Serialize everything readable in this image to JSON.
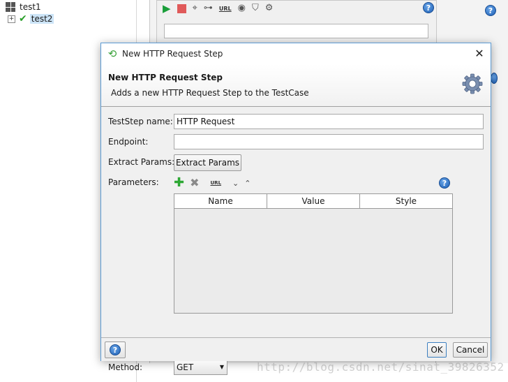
{
  "tree": {
    "items": [
      {
        "label": "test1",
        "icon": "grid-icon"
      },
      {
        "label": "test2",
        "icon": "check-icon"
      }
    ]
  },
  "bg_toolbar": {
    "url_label": "URL",
    "help": "?"
  },
  "dialog": {
    "window_title": "New HTTP Request Step",
    "close_glyph": "✕",
    "header_title": "New HTTP Request Step",
    "header_subtitle": "Adds a new HTTP Request Step to the TestCase",
    "fields": {
      "teststep_name_label": "TestStep name:",
      "teststep_name_value": "HTTP Request",
      "endpoint_label": "Endpoint:",
      "endpoint_value": "",
      "extract_params_label": "Extract Params:",
      "extract_params_button": "Extract Params",
      "parameters_label": "Parameters:",
      "method_label": "Method:",
      "method_value": "GET"
    },
    "params_table": {
      "columns": [
        "Name",
        "Value",
        "Style"
      ]
    },
    "footer": {
      "help": "?",
      "ok_label": "OK",
      "cancel_label": "Cancel"
    }
  },
  "watermark": "http://blog.csdn.net/sinat_39826352",
  "colors": {
    "accent_border": "#5b9bd5",
    "selection": "#cce4f7",
    "run_green": "#1a9e3a",
    "stop_red": "#e05a5a"
  }
}
